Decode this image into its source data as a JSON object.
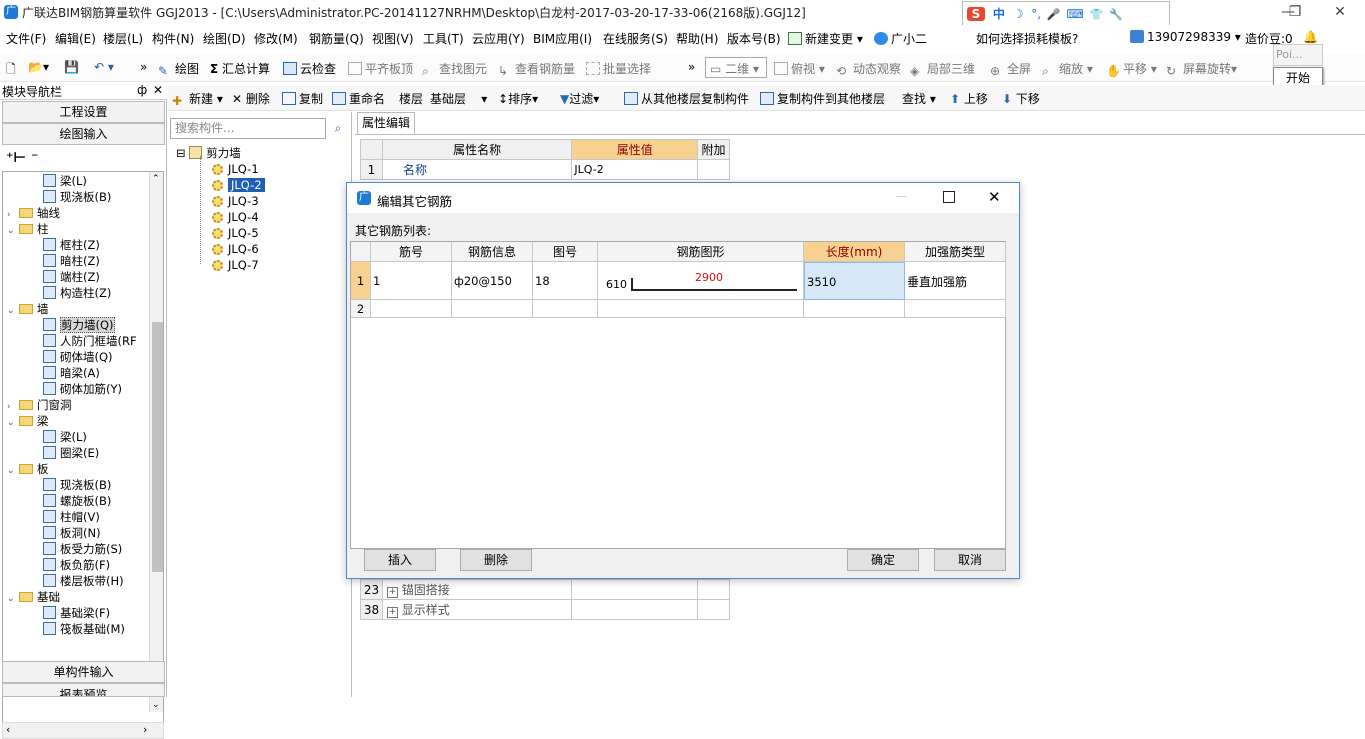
{
  "window": {
    "title": "广联达BIM钢筋算量软件 GGJ2013 - [C:\\Users\\Administrator.PC-20141127NRHM\\Desktop\\白龙村-2017-03-20-17-33-06(2168版).GGJ12]",
    "app_icon": "广",
    "minimize": "—",
    "restore": "❐",
    "close": "✕"
  },
  "ime": {
    "logo": "S",
    "mode": "中",
    "moon": "☽",
    "punct": "°,",
    "mic": "🎤",
    "kb": "⌨",
    "skin": "👕",
    "tools": "🔧"
  },
  "menu": [
    "文件(F)",
    "编辑(E)",
    "楼层(L)",
    "构件(N)",
    "绘图(D)",
    "修改(M)",
    "钢筋量(Q)",
    "视图(V)",
    "工具(T)",
    "云应用(Y)",
    "BIM应用(I)",
    "在线服务(S)",
    "帮助(H)",
    "版本号(B)",
    "新建变更",
    "广小二",
    "如何选择损耗模板?",
    "13907298339",
    "造价豆:0"
  ],
  "toolbar1": {
    "draw": "绘图",
    "sum": "汇总计算",
    "cloud_check": "云检查",
    "flat_slab": "平齐板顶",
    "find_elem": "查找图元",
    "view_rebar": "查看钢筋量",
    "batch_select": "批量选择",
    "view_mode": "二维",
    "top_view": "俯视",
    "dynamic": "动态观察",
    "local_3d": "局部三维",
    "fullscreen": "全屏",
    "zoom": "缩放",
    "pan": "平移",
    "rotate": "屏幕旋转"
  },
  "popup": {
    "poi": "Poi...",
    "start": "开始"
  },
  "leftnav": {
    "header": "模块导航栏",
    "pin": "ф",
    "close": "✕",
    "project_settings": "工程设置",
    "draw_input": "绘图输入",
    "single_input": "单构件输入",
    "report_preview": "报表预览",
    "tree": [
      {
        "label": "梁(L)",
        "level": 2,
        "type": "item"
      },
      {
        "label": "现浇板(B)",
        "level": 2,
        "type": "item"
      },
      {
        "label": "轴线",
        "level": 1,
        "type": "folder",
        "expand": ">"
      },
      {
        "label": "柱",
        "level": 1,
        "type": "folder",
        "expand": "v"
      },
      {
        "label": "框柱(Z)",
        "level": 2,
        "type": "item"
      },
      {
        "label": "暗柱(Z)",
        "level": 2,
        "type": "item"
      },
      {
        "label": "端柱(Z)",
        "level": 2,
        "type": "item"
      },
      {
        "label": "构造柱(Z)",
        "level": 2,
        "type": "item"
      },
      {
        "label": "墙",
        "level": 1,
        "type": "folder",
        "expand": "v"
      },
      {
        "label": "剪力墙(Q)",
        "level": 2,
        "type": "item",
        "selected": true
      },
      {
        "label": "人防门框墙(RF",
        "level": 2,
        "type": "item"
      },
      {
        "label": "砌体墙(Q)",
        "level": 2,
        "type": "item"
      },
      {
        "label": "暗梁(A)",
        "level": 2,
        "type": "item"
      },
      {
        "label": "砌体加筋(Y)",
        "level": 2,
        "type": "item"
      },
      {
        "label": "门窗洞",
        "level": 1,
        "type": "folder",
        "expand": ">"
      },
      {
        "label": "梁",
        "level": 1,
        "type": "folder",
        "expand": "v"
      },
      {
        "label": "梁(L)",
        "level": 2,
        "type": "item"
      },
      {
        "label": "圈梁(E)",
        "level": 2,
        "type": "item"
      },
      {
        "label": "板",
        "level": 1,
        "type": "folder",
        "expand": "v"
      },
      {
        "label": "现浇板(B)",
        "level": 2,
        "type": "item"
      },
      {
        "label": "螺旋板(B)",
        "level": 2,
        "type": "item"
      },
      {
        "label": "柱帽(V)",
        "level": 2,
        "type": "item"
      },
      {
        "label": "板洞(N)",
        "level": 2,
        "type": "item"
      },
      {
        "label": "板受力筋(S)",
        "level": 2,
        "type": "item"
      },
      {
        "label": "板负筋(F)",
        "level": 2,
        "type": "item"
      },
      {
        "label": "楼层板带(H)",
        "level": 2,
        "type": "item"
      },
      {
        "label": "基础",
        "level": 1,
        "type": "folder",
        "expand": "v"
      },
      {
        "label": "基础梁(F)",
        "level": 2,
        "type": "item"
      },
      {
        "label": "筏板基础(M)",
        "level": 2,
        "type": "item"
      }
    ]
  },
  "comp_toolbar": {
    "new": "新建",
    "delete": "删除",
    "copy": "复制",
    "rename": "重命名",
    "floor": "楼层",
    "floor_value": "基础层",
    "sort": "排序",
    "filter": "过滤",
    "copy_from": "从其他楼层复制构件",
    "copy_to": "复制构件到其他楼层",
    "find": "查找",
    "up": "上移",
    "down": "下移"
  },
  "component_list": {
    "search_placeholder": "搜索构件...",
    "root": "剪力墙",
    "items": [
      "JLQ-1",
      "JLQ-2",
      "JLQ-3",
      "JLQ-4",
      "JLQ-5",
      "JLQ-6",
      "JLQ-7"
    ],
    "selected": "JLQ-2"
  },
  "property_panel": {
    "tab": "属性编辑",
    "headers": [
      "属性名称",
      "属性值",
      "附加"
    ],
    "rows": [
      {
        "num": "1",
        "name": "名称",
        "value": "JLQ-2"
      },
      {
        "num": "23",
        "name": "锚固搭接",
        "value": "",
        "expander": "+"
      },
      {
        "num": "38",
        "name": "显示样式",
        "value": "",
        "expander": "+"
      }
    ]
  },
  "dialog": {
    "title": "编辑其它钢筋",
    "list_label": "其它钢筋列表:",
    "headers": [
      "筋号",
      "钢筋信息",
      "图号",
      "钢筋图形",
      "长度(mm)",
      "加强筋类型"
    ],
    "rows": [
      {
        "num": "1",
        "bar_no": "1",
        "info": "ф20@150",
        "fig": "18",
        "shape_left": "610",
        "shape_top": "2900",
        "length": "3510",
        "type": "垂直加强筋"
      },
      {
        "num": "2",
        "bar_no": "",
        "info": "",
        "fig": "",
        "shape_left": "",
        "shape_top": "",
        "length": "",
        "type": ""
      }
    ],
    "btn_insert": "插入",
    "btn_delete": "删除",
    "btn_ok": "确定",
    "btn_cancel": "取消"
  }
}
